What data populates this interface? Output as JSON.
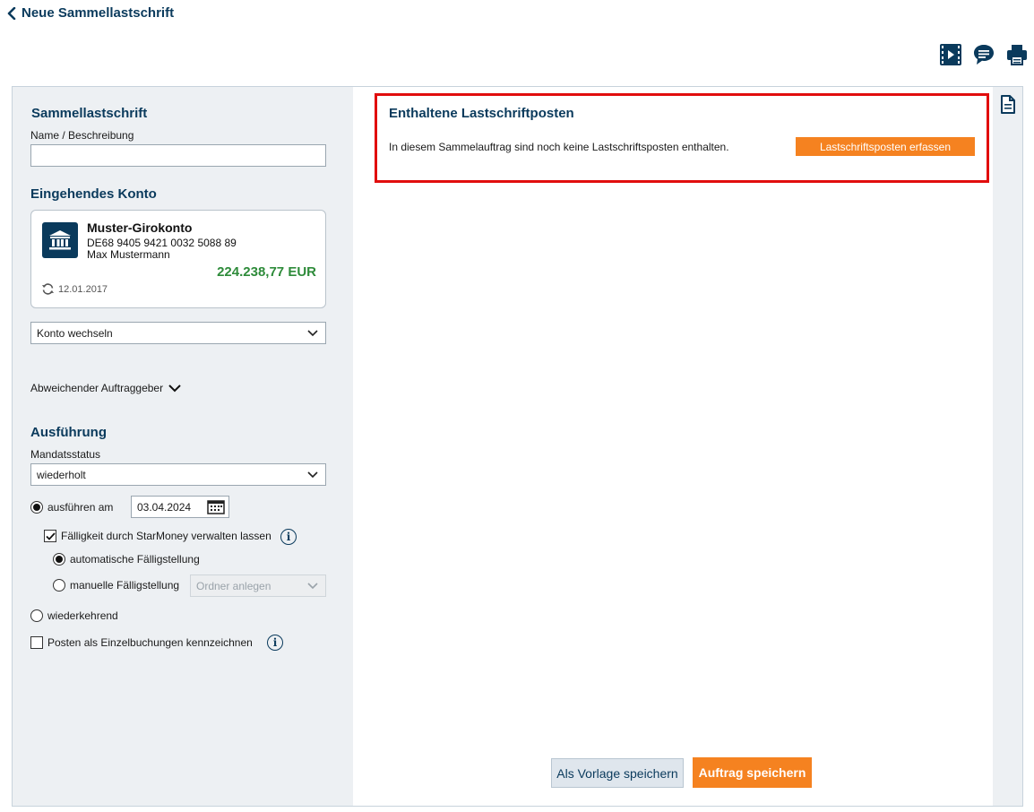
{
  "header": {
    "back_label": "Neue Sammellastschrift",
    "icons": [
      "video-icon",
      "chat-icon",
      "print-icon"
    ]
  },
  "left": {
    "collective_title": "Sammellastschrift",
    "name_label": "Name / Beschreibung",
    "name_value": "",
    "incoming_account_title": "Eingehendes Konto",
    "account": {
      "name": "Muster-Girokonto",
      "iban": "DE68 9405 9421 0032 5088 89",
      "owner": "Max Mustermann",
      "balance": "224.238,77 EUR",
      "sync_date": "12.01.2017"
    },
    "switch_account_label": "Konto wechseln",
    "different_originator_label": "Abweichender Auftraggeber",
    "execution_title": "Ausführung",
    "mandate_status_label": "Mandatsstatus",
    "mandate_status_value": "wiederholt",
    "execute_on_label": "ausführen am",
    "execute_date": "03.04.2024",
    "due_managed_label": "Fälligkeit durch StarMoney verwalten lassen",
    "auto_due_label": "automatische Fälligstellung",
    "manual_due_label": "manuelle Fälligstellung",
    "folder_placeholder": "Ordner anlegen",
    "recurring_label": "wiederkehrend",
    "single_booking_label": "Posten als Einzelbuchungen kennzeichnen"
  },
  "right": {
    "title": "Enthaltene Lastschriftposten",
    "empty_text": "In diesem Sammelauftrag sind noch keine Lastschriftsposten enthalten.",
    "add_item_label": "Lastschriftsposten erfassen",
    "save_template_label": "Als Vorlage speichern",
    "save_order_label": "Auftrag speichern"
  },
  "colors": {
    "brand_dark": "#0a3a5c",
    "accent_orange": "#f58220",
    "balance_green": "#2e8b3a",
    "highlight_red": "#e10d0d"
  }
}
